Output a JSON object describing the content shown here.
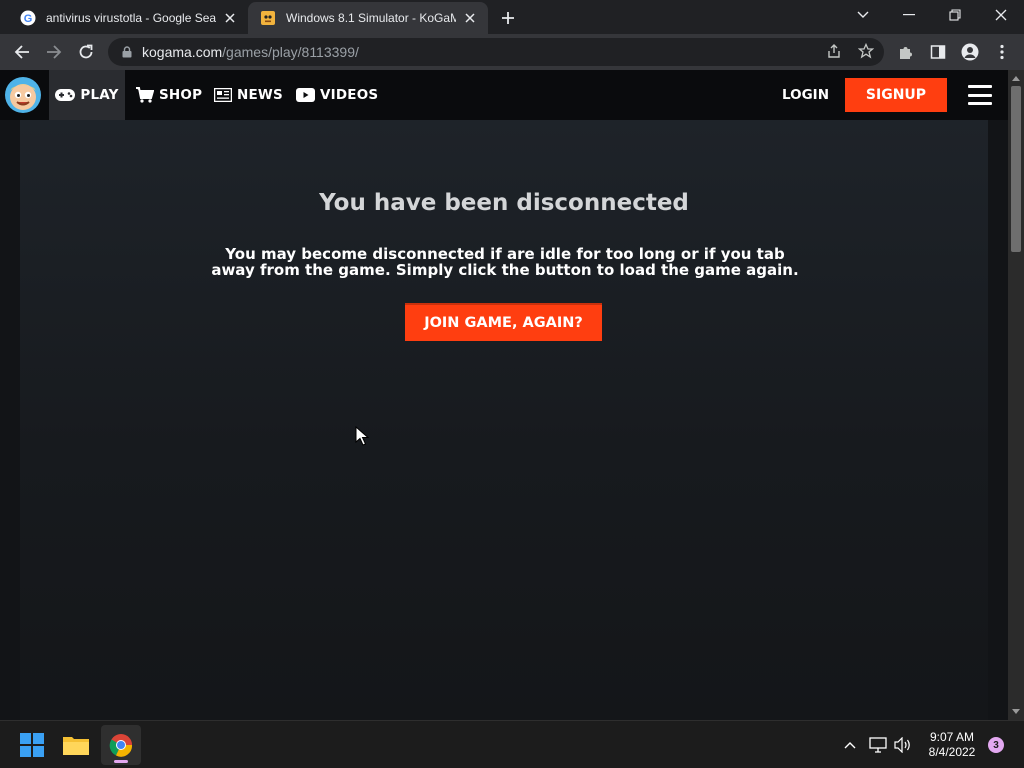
{
  "browser": {
    "tabs": [
      {
        "title": "antivirus virustotla - Google Search",
        "favicon": "google-icon",
        "active": false
      },
      {
        "title": "Windows 8.1 Simulator - KoGaMa",
        "favicon": "kogama-favicon",
        "active": true
      }
    ],
    "url_host": "kogama.com",
    "url_path": "/games/play/8113399/"
  },
  "site": {
    "nav": [
      {
        "label": "PLAY",
        "icon": "gamepad-icon"
      },
      {
        "label": "SHOP",
        "icon": "cart-icon"
      },
      {
        "label": "NEWS",
        "icon": "newspaper-icon"
      },
      {
        "label": "VIDEOS",
        "icon": "youtube-icon"
      }
    ],
    "login_label": "LOGIN",
    "signup_label": "SIGNUP"
  },
  "main": {
    "heading": "You have been disconnected",
    "message": "You may become disconnected if are idle for too long or if you tab away from the game. Simply click the button to load the game again.",
    "button_label": "JOIN GAME, AGAIN?"
  },
  "taskbar": {
    "apps": [
      "windows-start-icon",
      "file-explorer-icon",
      "chrome-icon"
    ],
    "time": "9:07 AM",
    "date": "8/4/2022",
    "notification_count": "3"
  },
  "colors": {
    "accent": "#ff3e10",
    "header_bg": "#0a0b0d",
    "panel_bg": "#1e2329"
  }
}
